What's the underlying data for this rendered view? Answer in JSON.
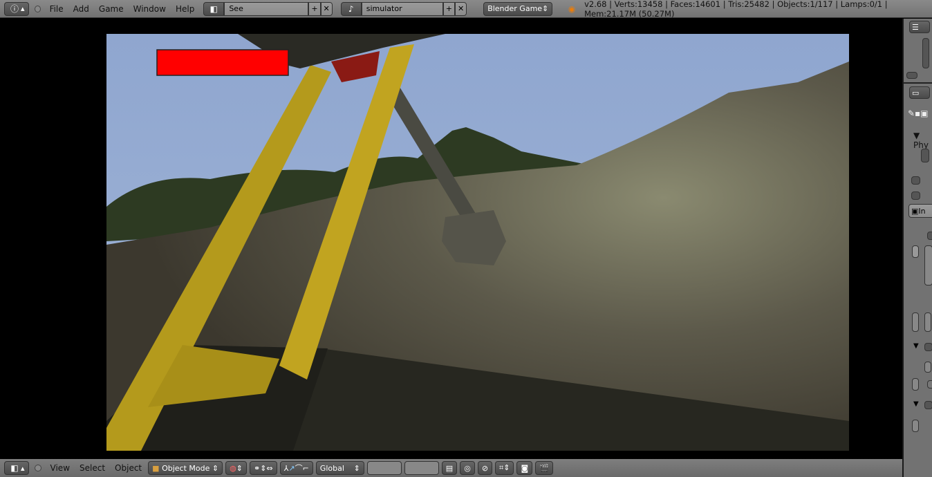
{
  "top_bar": {
    "menus": [
      "File",
      "Add",
      "Game",
      "Window",
      "Help"
    ],
    "screen_layout": "See",
    "scene": "simulator",
    "engine": "Blender Game",
    "stats": "v2.68 | Verts:13458 | Faces:14601 | Tris:25482 | Objects:1/117 | Lamps:0/1 | Mem:21.17M (50.27M)"
  },
  "bottom_bar": {
    "menus": [
      "View",
      "Select",
      "Object"
    ],
    "mode": "Object Mode",
    "orientation": "Global"
  },
  "properties": {
    "panel_label": "Phy",
    "button_label": "In"
  },
  "hud": {
    "health_bar_color": "#ff0000"
  }
}
